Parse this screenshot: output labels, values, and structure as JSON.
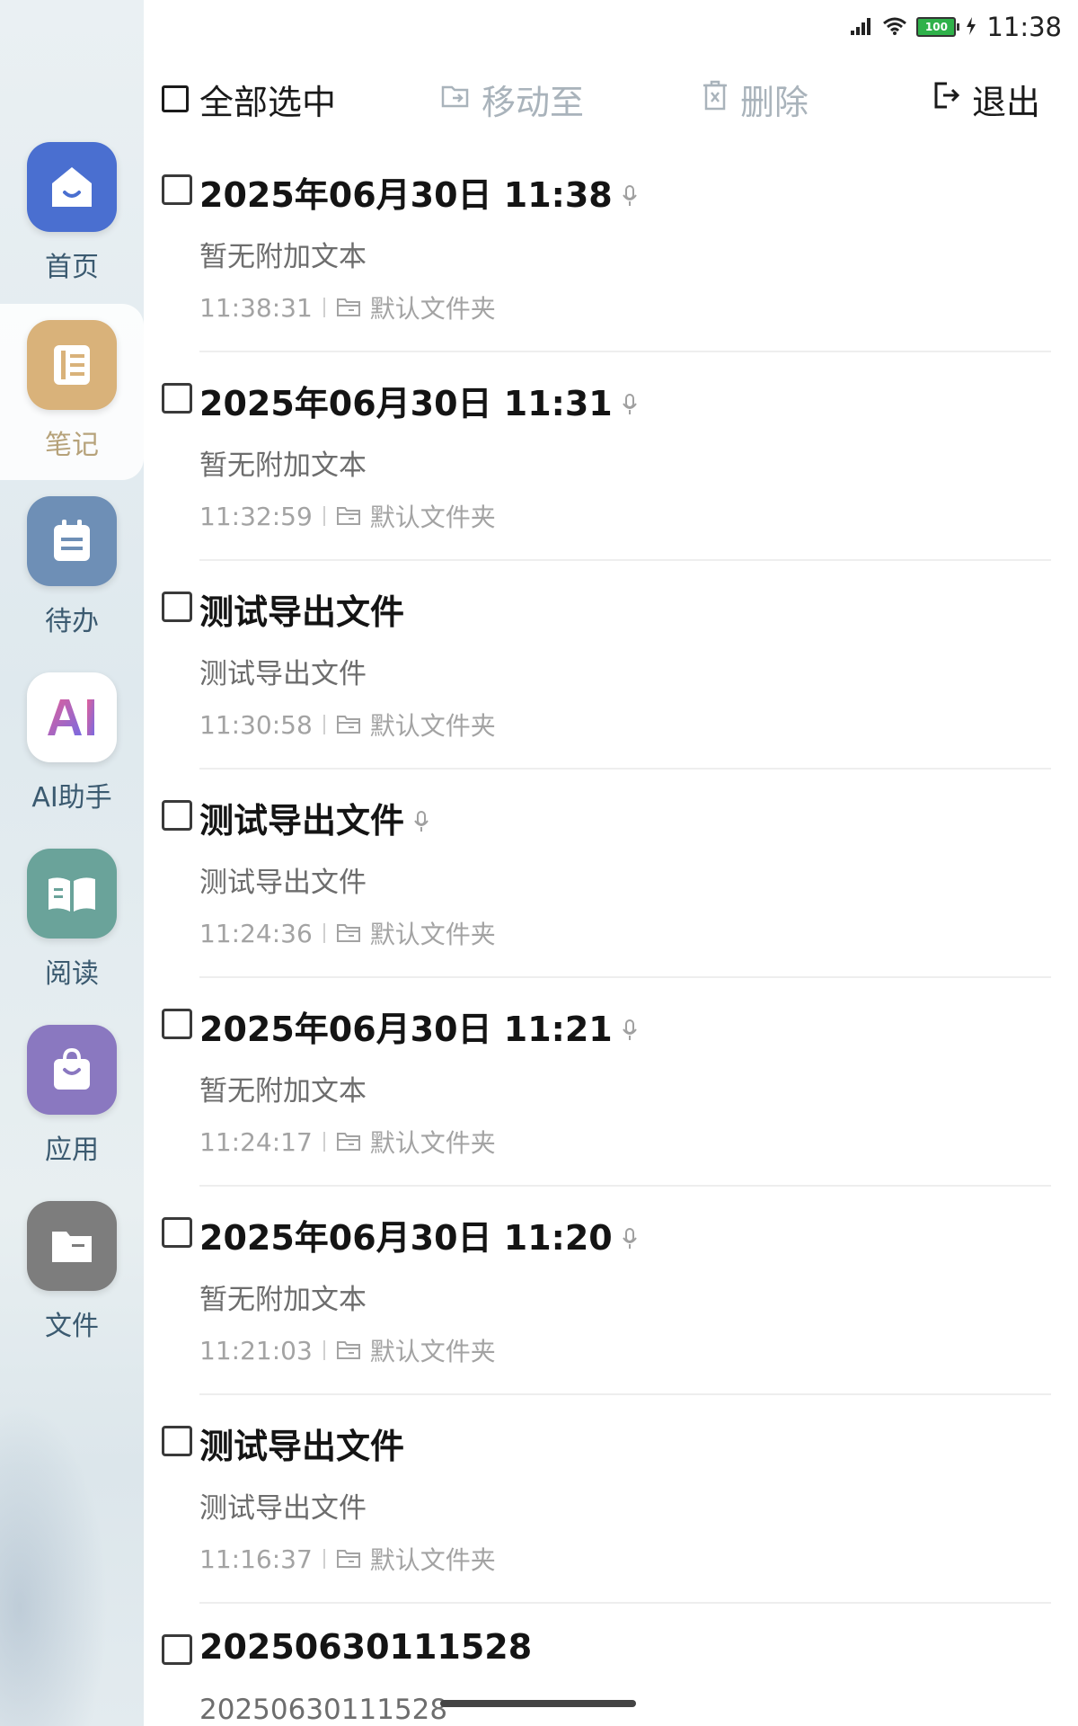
{
  "status_bar": {
    "time": "11:38",
    "battery_level": "100",
    "signal_icon": "signal-icon",
    "wifi_icon": "wifi-icon",
    "charging_icon": "charging-icon"
  },
  "toolbar": {
    "select_all": "全部选中",
    "move_to": "移动至",
    "delete": "删除",
    "exit": "退出"
  },
  "sidebar": {
    "items": [
      {
        "label": "首页",
        "icon": "home-icon",
        "color": "#4a6fd0"
      },
      {
        "label": "笔记",
        "icon": "notebook-icon",
        "color": "#d9b27a"
      },
      {
        "label": "待办",
        "icon": "todo-icon",
        "color": "#6e8fb6"
      },
      {
        "label": "AI助手",
        "icon": "ai-icon",
        "color": "#ffffff"
      },
      {
        "label": "阅读",
        "icon": "book-icon",
        "color": "#6aa39a"
      },
      {
        "label": "应用",
        "icon": "bag-icon",
        "color": "#8a78c0"
      },
      {
        "label": "文件",
        "icon": "folder-icon",
        "color": "#7d7d7d"
      }
    ]
  },
  "notes": [
    {
      "title": "2025年06月30日 11:38",
      "has_audio": true,
      "subtitle": "暂无附加文本",
      "time": "11:38:31",
      "folder": "默认文件夹"
    },
    {
      "title": "2025年06月30日 11:31",
      "has_audio": true,
      "subtitle": "暂无附加文本",
      "time": "11:32:59",
      "folder": "默认文件夹"
    },
    {
      "title": "测试导出文件",
      "has_audio": false,
      "subtitle": "测试导出文件",
      "time": "11:30:58",
      "folder": "默认文件夹"
    },
    {
      "title": "测试导出文件",
      "has_audio": true,
      "subtitle": "测试导出文件",
      "time": "11:24:36",
      "folder": "默认文件夹"
    },
    {
      "title": "2025年06月30日 11:21",
      "has_audio": true,
      "subtitle": "暂无附加文本",
      "time": "11:24:17",
      "folder": "默认文件夹"
    },
    {
      "title": "2025年06月30日 11:20",
      "has_audio": true,
      "subtitle": "暂无附加文本",
      "time": "11:21:03",
      "folder": "默认文件夹"
    },
    {
      "title": "测试导出文件",
      "has_audio": false,
      "subtitle": "测试导出文件",
      "time": "11:16:37",
      "folder": "默认文件夹"
    },
    {
      "title": "20250630111528",
      "has_audio": false,
      "subtitle": "20250630111528",
      "time": "",
      "folder": ""
    }
  ]
}
